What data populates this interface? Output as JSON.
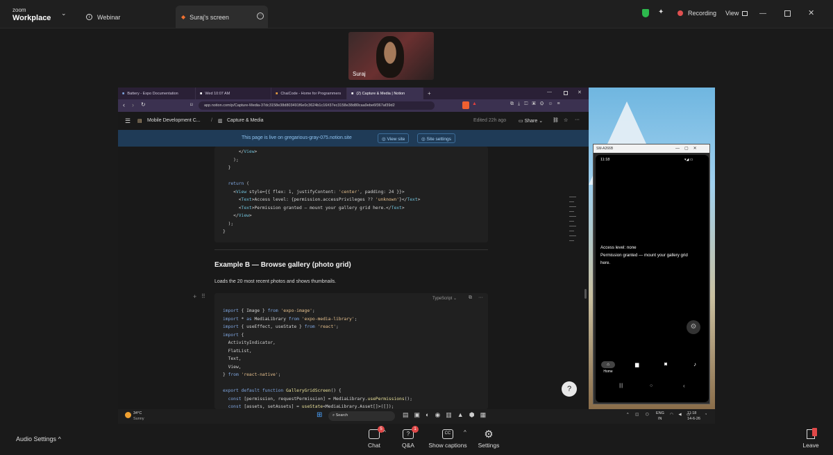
{
  "zoom": {
    "logo_top": "zoom",
    "logo_bottom": "Workplace",
    "tab_webinar": "Webinar",
    "tab_screen": "Suraj's screen",
    "recording": "Recording",
    "view": "View",
    "presenter_name": "Suraj"
  },
  "browser": {
    "tabs": [
      "Battery - Expo Documentation",
      "Wed 10:07 AM",
      "ChaiCode - Home for Programmers",
      "(2) Capture & Media | Notion"
    ],
    "url": "app.notion.com/p/Capture-Media-37dc3158e38d803491f6e0c3624b1c16#37ec3158e38d80caa9ebe6f367af39d2"
  },
  "notion": {
    "breadcrumb_1": "Mobile Development C...",
    "breadcrumb_2": "Capture & Media",
    "edited": "Edited 22h ago",
    "share": "Share",
    "banner_text": "This page is live on gregarious-gray-075.notion.site",
    "view_site": "View site",
    "site_settings": "Site settings",
    "heading": "Example B — Browse gallery (photo grid)",
    "subtext": "Loads the 20 most recent photos and shows thumbnails.",
    "lang_label": "TypeScript"
  },
  "emulator": {
    "title": "SM-A266B",
    "time": "11:18",
    "line1": "Access level: none",
    "line2": "Permission granted — mount your gallery grid",
    "line3": "here.",
    "nav_home": "Home"
  },
  "taskbar": {
    "weather_temp": "34°C",
    "weather_desc": "Sunny",
    "search": "Search",
    "lang1": "ENG",
    "lang2": "IN",
    "time": "11:18",
    "date": "14-6-26"
  },
  "controls": {
    "audio": "Audio Settings",
    "chat": "Chat",
    "chat_badge": "5",
    "qa": "Q&A",
    "qa_badge": "1",
    "captions": "Show captions",
    "settings": "Settings",
    "leave": "Leave"
  },
  "colors": {
    "zoom_bg": "#1a1a1a",
    "browser_tabbar": "#2a2036",
    "banner_bg": "#1f3b57",
    "badge_red": "#e04848"
  }
}
